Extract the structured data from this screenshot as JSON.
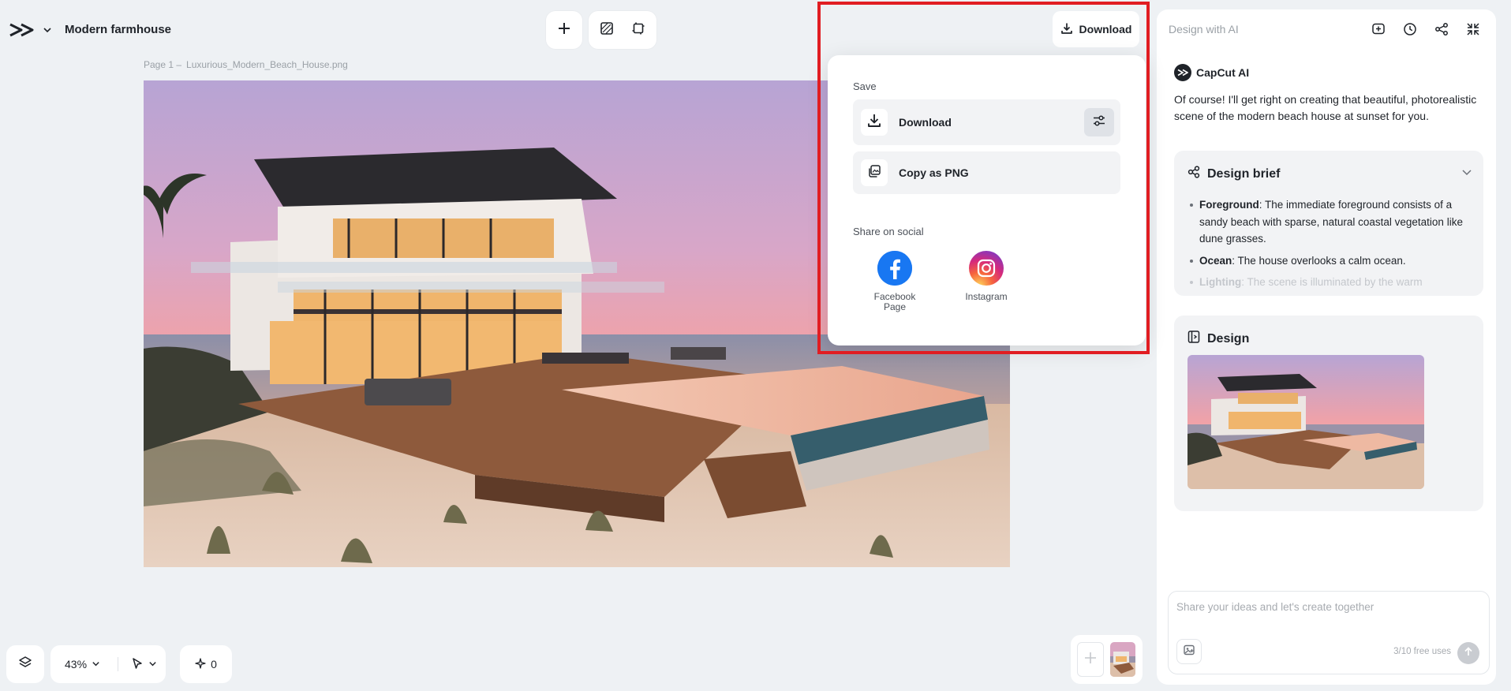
{
  "project": {
    "title": "Modern farmhouse"
  },
  "canvas": {
    "page_label": "Page 1 –",
    "file_name": "Luxurious_Modern_Beach_House.png"
  },
  "top_download": {
    "label": "Download"
  },
  "dropdown": {
    "save_label": "Save",
    "download_label": "Download",
    "copy_label": "Copy as PNG",
    "share_label": "Share on social",
    "social": [
      {
        "name": "Facebook Page",
        "icon": "facebook-icon",
        "color": "#1877f2"
      },
      {
        "name": "Instagram",
        "icon": "instagram-icon"
      }
    ]
  },
  "panel": {
    "title": "Design with AI",
    "ai_name": "CapCut AI",
    "ai_message": "Of course! I'll get right on creating that beautiful, photorealistic scene of the modern beach house at sunset for you.",
    "brief": {
      "title": "Design brief",
      "items": [
        {
          "label": "Foreground",
          "text": ": The immediate foreground consists of a sandy beach with sparse, natural coastal vegetation like dune grasses."
        },
        {
          "label": "Ocean",
          "text": ": The house overlooks a calm ocean."
        },
        {
          "label": "Lighting",
          "text": ": The scene is illuminated by the warm"
        }
      ]
    },
    "design": {
      "title": "Design"
    },
    "prompt": {
      "placeholder": "Share your ideas and let's create together",
      "free_uses": "3/10 free uses"
    }
  },
  "bottom": {
    "zoom": "43%",
    "spark_count": "0"
  }
}
